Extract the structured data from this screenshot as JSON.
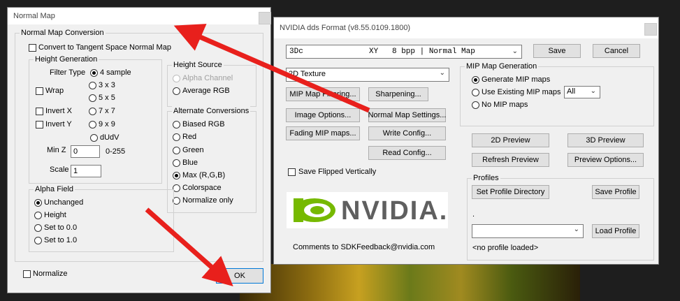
{
  "colors": {
    "desktop": "#1e1e1e",
    "window": "#f0f0f0",
    "arrow": "#e8201c",
    "nvidia_green": "#76b900"
  },
  "normal_map": {
    "title": "Normal Map",
    "conversion_group": "Normal Map Conversion",
    "convert_tangent": "Convert to Tangent Space Normal Map",
    "height_gen": {
      "label": "Height Generation",
      "filter_type": "Filter Type",
      "opt_4sample": "4 sample",
      "opt_3x3": "3 x 3",
      "opt_5x5": "5 x 5",
      "opt_7x7": "7 x 7",
      "opt_9x9": "9 x 9",
      "opt_dudv": "dUdV",
      "wrap": "Wrap",
      "invert_x": "Invert X",
      "invert_y": "Invert Y",
      "minz_label": "Min Z",
      "minz_value": "0",
      "range": "0-255",
      "scale_label": "Scale",
      "scale_value": "1"
    },
    "height_source": {
      "label": "Height Source",
      "alpha": "Alpha Channel",
      "avg_rgb": "Average RGB"
    },
    "alt_conv": {
      "label": "Alternate Conversions",
      "biased": "Biased RGB",
      "red": "Red",
      "green": "Green",
      "blue": "Blue",
      "max": "Max (R,G,B)",
      "colorspace": "Colorspace",
      "normalize_only": "Normalize only"
    },
    "alpha_field": {
      "label": "Alpha Field",
      "unchanged": "Unchanged",
      "height": "Height",
      "set0": "Set to 0.0",
      "set1": "Set to 1.0"
    },
    "normalize": "Normalize",
    "ok": "OK"
  },
  "nvidia": {
    "title": "NVIDIA dds Format (v8.55.0109.1800)",
    "format_name": "3Dc",
    "format_mid": "XY   8 bpp | Normal Map",
    "save": "Save",
    "cancel": "Cancel",
    "texture_type": "2D Texture",
    "btn_mip_filter": "MIP Map Filtering...",
    "btn_sharpen": "Sharpening...",
    "btn_image_opts": "Image Options...",
    "btn_normal_map": "Normal Map Settings...",
    "btn_fading": "Fading MIP maps...",
    "btn_write_config": "Write Config...",
    "btn_read_config": "Read Config...",
    "save_flipped": "Save Flipped Vertically",
    "mip_gen": {
      "label": "MIP Map Generation",
      "generate": "Generate MIP maps",
      "use_existing": "Use Existing MIP maps",
      "existing_value": "All",
      "none": "No MIP maps"
    },
    "btn_2d_preview": "2D Preview",
    "btn_3d_preview": "3D Preview",
    "btn_refresh": "Refresh Preview",
    "btn_preview_opts": "Preview Options...",
    "profiles": {
      "label": "Profiles",
      "set_dir": "Set Profile Directory",
      "save_profile": "Save Profile",
      "dir_value": ".",
      "load_profile": "Load Profile",
      "status": "<no profile loaded>"
    },
    "logo_text": "NVIDIA.",
    "comments": "Comments to SDKFeedback@nvidia.com"
  }
}
